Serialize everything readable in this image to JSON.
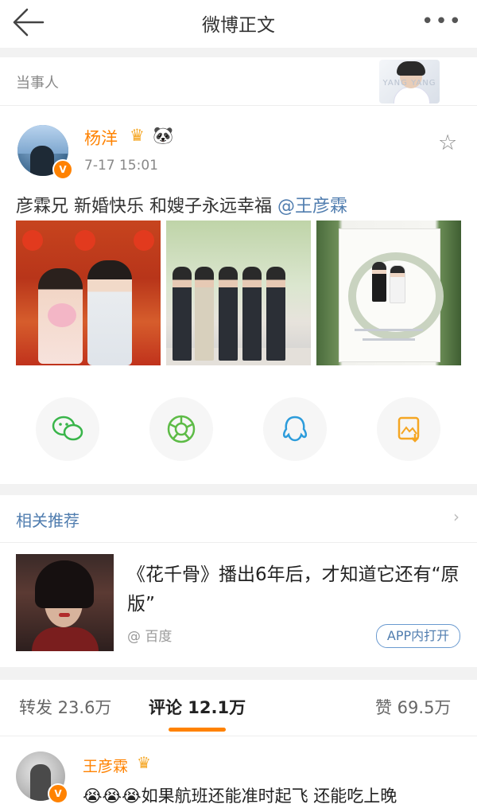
{
  "header": {
    "title": "微博正文",
    "back_icon": "arrow-left-icon",
    "more_label": "•••"
  },
  "party": {
    "label": "当事人",
    "watermark": "YANG YANG"
  },
  "post": {
    "author": "杨洋",
    "verified": "V",
    "time": "7-17 15:01",
    "text": "彦霖兄 新婚快乐 和嫂子永远幸福 ",
    "mention": "@王彦霖",
    "crown": "♛",
    "panda": "🐼",
    "star": "☆"
  },
  "share": [
    "wechat-icon",
    "moments-icon",
    "qq-icon",
    "save-image-icon"
  ],
  "related": {
    "title": "相关推荐",
    "chevron": "›",
    "item_title": "《花千骨》播出6年后，才知道它还有“原版”",
    "source": "@ 百度",
    "app_button": "APP内打开"
  },
  "tabs": {
    "repost": "转发 23.6万",
    "comment": "评论 12.1万",
    "like": "赞 69.5万"
  },
  "comment": {
    "author": "王彦霖",
    "crown": "♛",
    "verified": "V",
    "text": "😭😭😭如果航班还能准时起飞 还能吃上晚"
  },
  "colors": {
    "accent": "#ff8200",
    "link": "#507daf"
  }
}
